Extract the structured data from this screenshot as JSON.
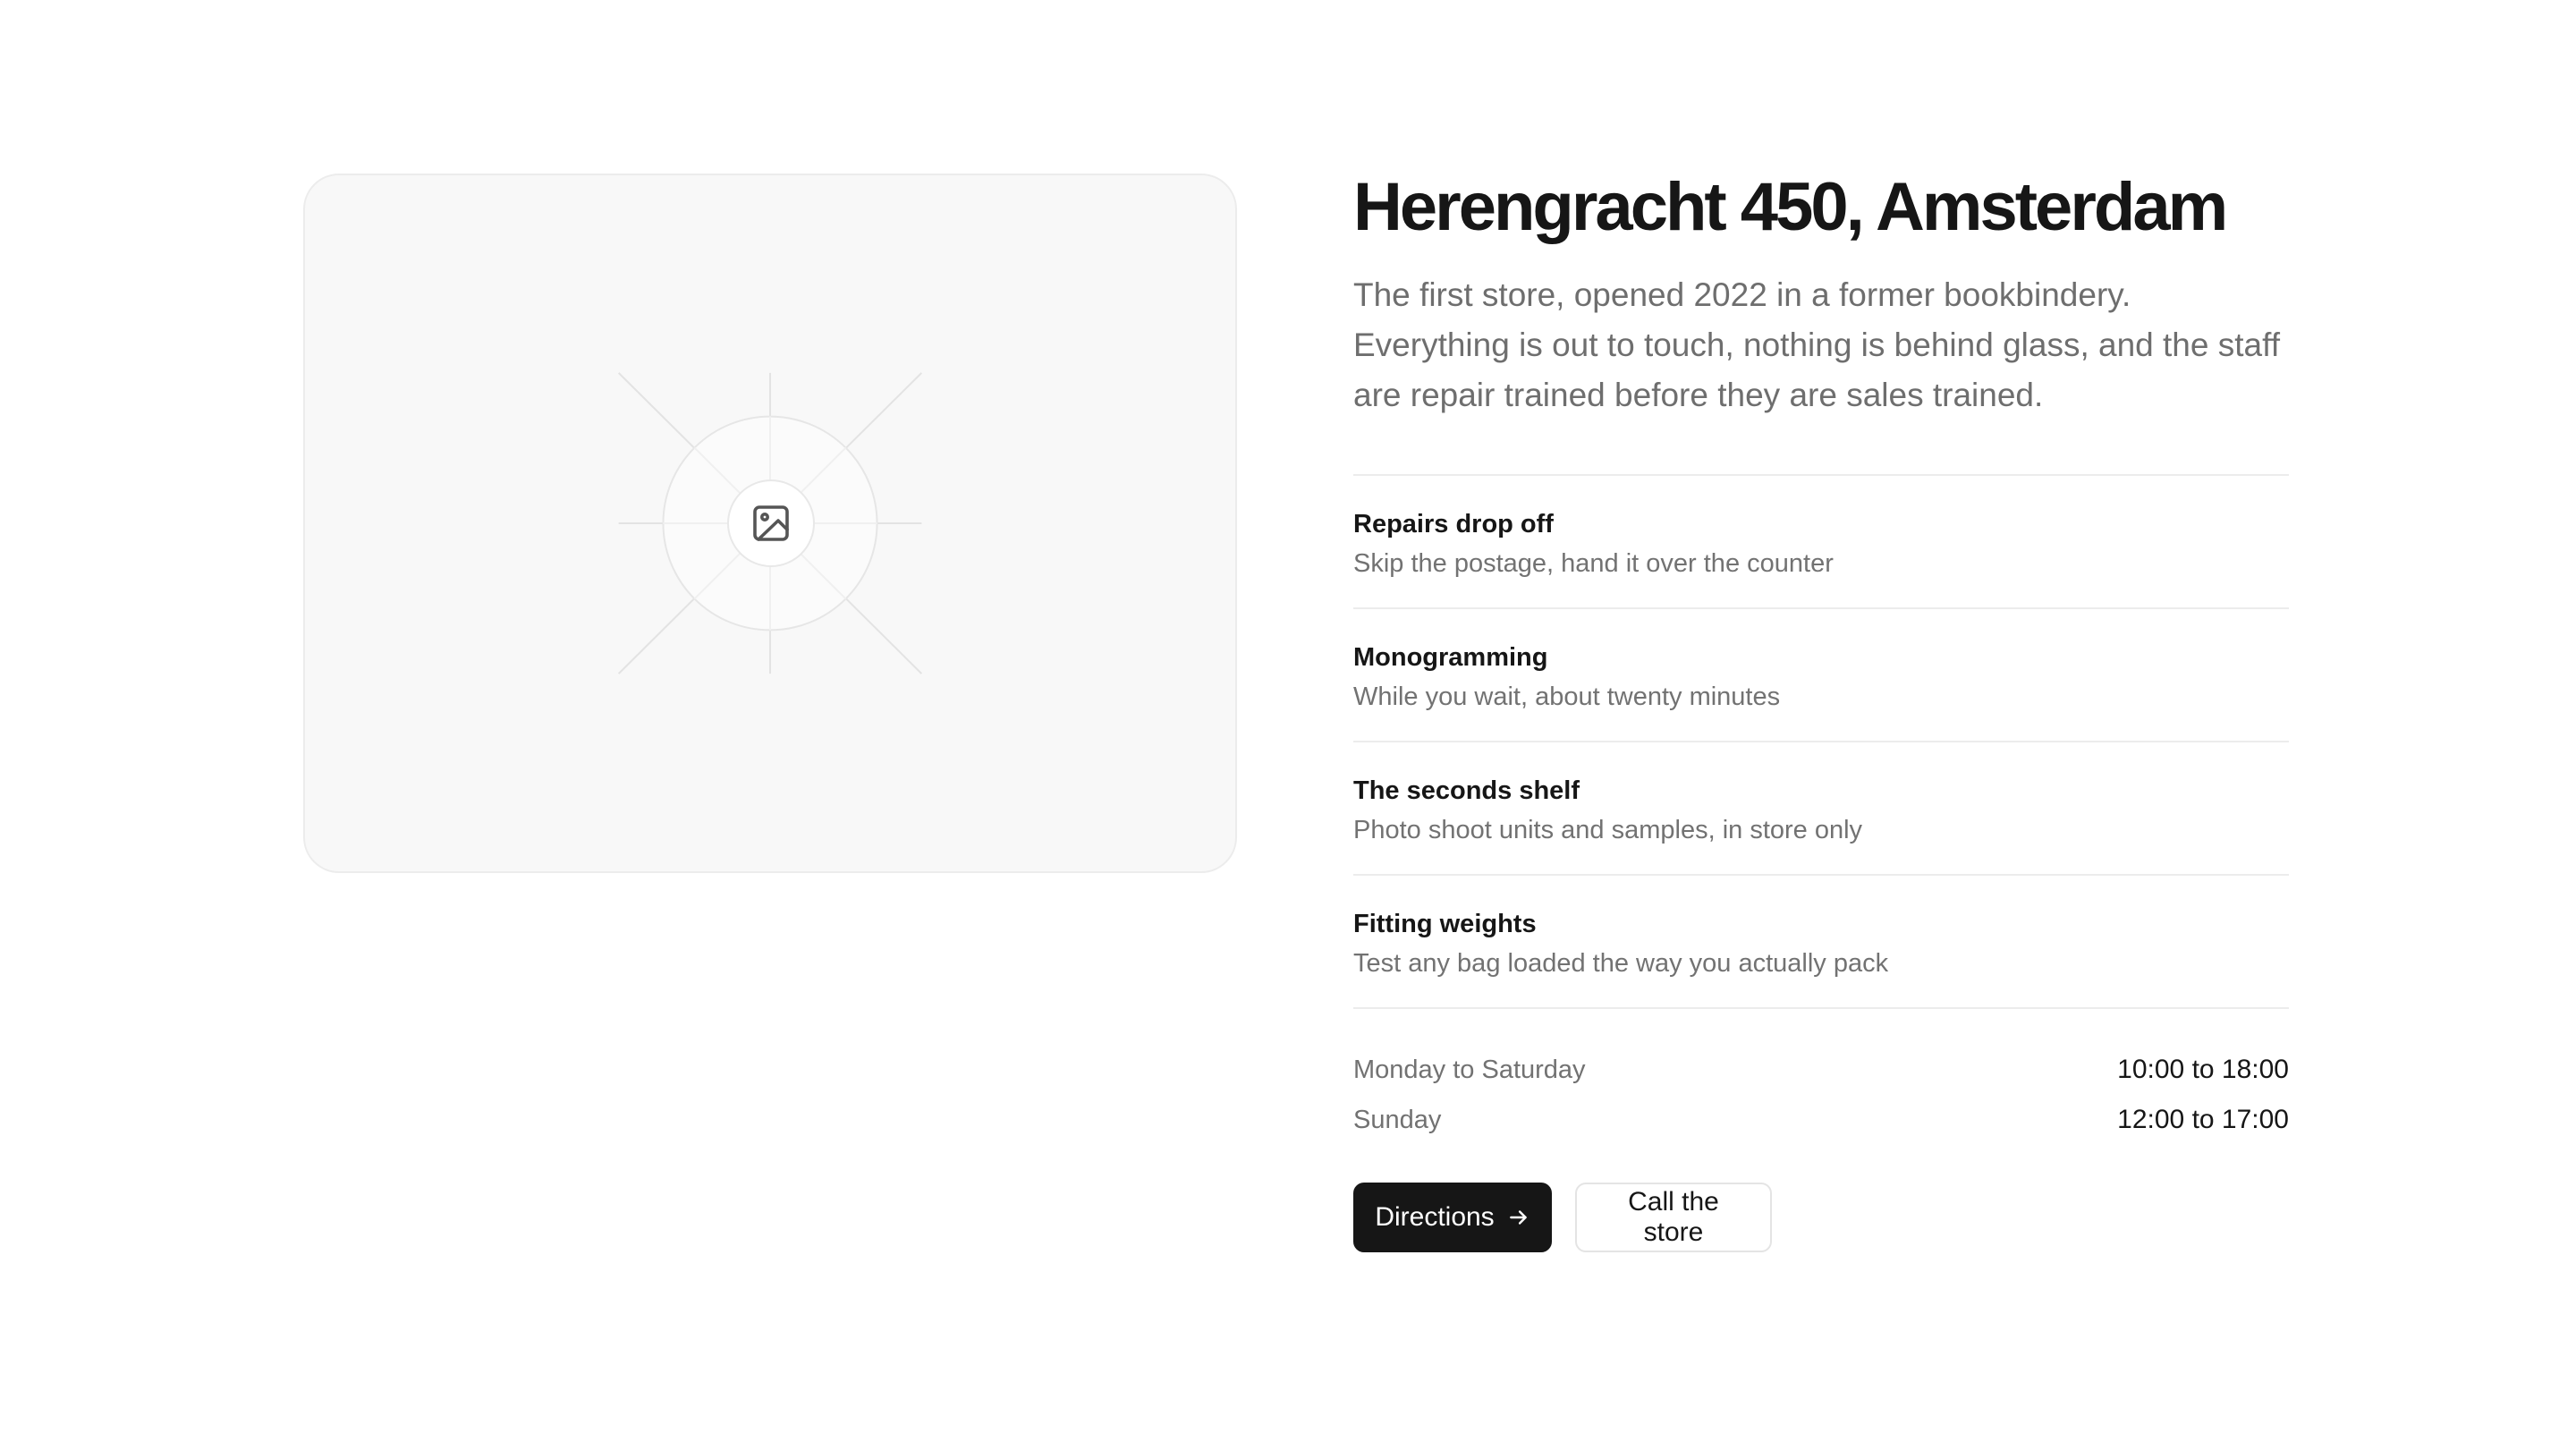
{
  "store": {
    "title": "Herengracht 450, Amsterdam",
    "description": "The first store, opened 2022 in a former bookbindery. Everything is out to touch, nothing is behind glass, and the staff are repair trained before they are sales trained."
  },
  "media": {
    "icon": "image-icon"
  },
  "features": [
    {
      "title": "Repairs drop off",
      "subtitle": "Skip the postage, hand it over the counter"
    },
    {
      "title": "Monogramming",
      "subtitle": "While you wait, about twenty minutes"
    },
    {
      "title": "The seconds shelf",
      "subtitle": "Photo shoot units and samples, in store only"
    },
    {
      "title": "Fitting weights",
      "subtitle": "Test any bag loaded the way you actually pack"
    }
  ],
  "hours": [
    {
      "day": "Monday to Saturday",
      "time": "10:00 to 18:00"
    },
    {
      "day": "Sunday",
      "time": "12:00 to 17:00"
    }
  ],
  "actions": {
    "directions_label": "Directions",
    "directions_icon": "arrow-right-icon",
    "call_label": "Call the store"
  },
  "colors": {
    "primary_button": "#161616",
    "text_primary": "#161616",
    "text_muted": "#727272",
    "divider": "#ececec",
    "card_background": "#f8f8f8"
  }
}
